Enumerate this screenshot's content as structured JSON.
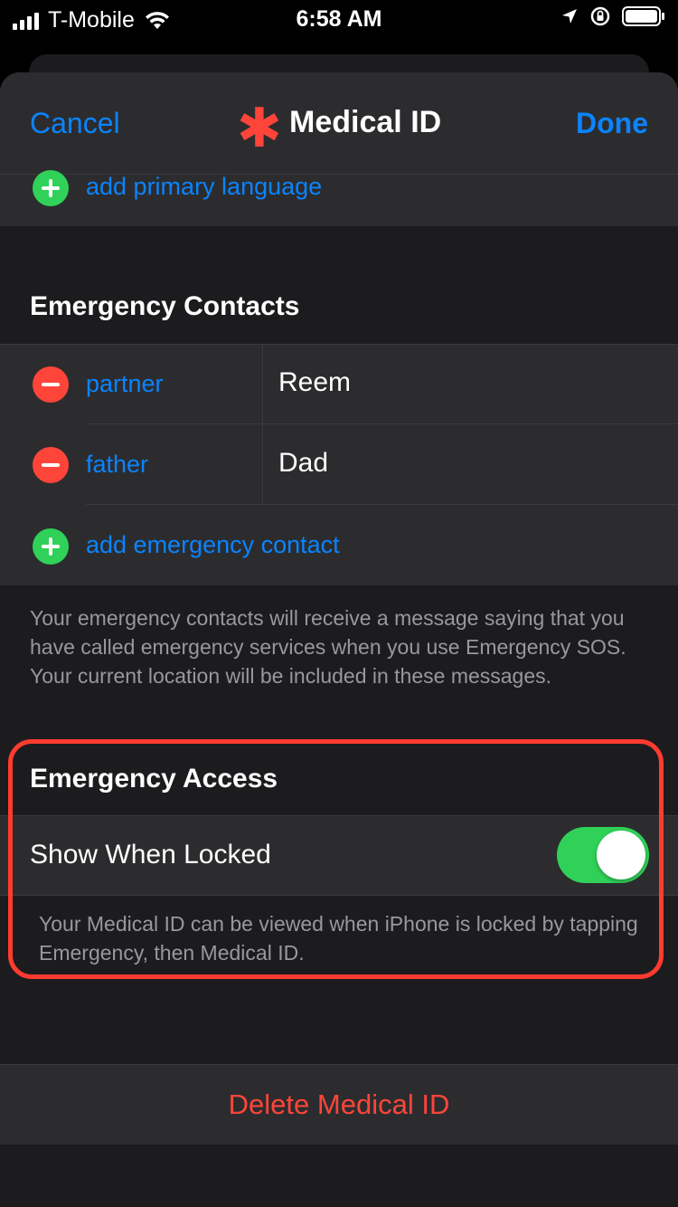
{
  "status_bar": {
    "carrier": "T-Mobile",
    "time": "6:58 AM"
  },
  "nav": {
    "cancel_label": "Cancel",
    "title": "Medical ID",
    "done_label": "Done"
  },
  "language": {
    "add_label": "add primary language"
  },
  "emergency_contacts": {
    "header": "Emergency Contacts",
    "contacts": [
      {
        "relationship": "partner",
        "name": "Reem"
      },
      {
        "relationship": "father",
        "name": "Dad"
      }
    ],
    "add_label": "add emergency contact",
    "footer": "Your emergency contacts will receive a message saying that you have called emergency services when you use Emergency SOS. Your current location will be included in these messages."
  },
  "emergency_access": {
    "header": "Emergency Access",
    "show_when_locked_label": "Show When Locked",
    "show_when_locked_enabled": true,
    "footer": "Your Medical ID can be viewed when iPhone is locked by tapping Emergency, then Medical ID."
  },
  "delete_label": "Delete Medical ID",
  "colors": {
    "accent_blue": "#0a84ff",
    "destructive_red": "#ff453a",
    "toggle_green": "#30d158",
    "highlight_red": "#ff3b30"
  }
}
